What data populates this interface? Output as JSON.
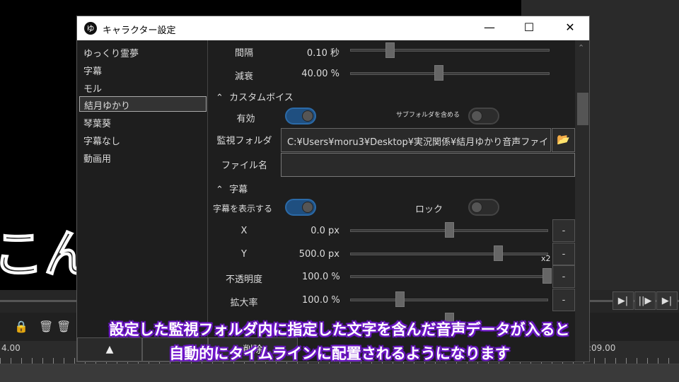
{
  "preview": {
    "text": "こんに"
  },
  "playback": {
    "buttons": [
      {
        "icon": "step-play-icon",
        "glyph": "▶|"
      },
      {
        "icon": "frame-forward-icon",
        "glyph": "||▶"
      },
      {
        "icon": "skip-end-icon",
        "glyph": "▶|"
      }
    ]
  },
  "timeline": {
    "time_left": "4.00",
    "time_right": ":09.00"
  },
  "window": {
    "title": "キャラクター設定",
    "app_icon": "ゆ",
    "min": "—",
    "max": "☐",
    "close": "✕"
  },
  "list": {
    "items": [
      "ゆっくり霊夢",
      "字幕",
      "モル",
      "結月ゆかり",
      "琴葉葵",
      "字幕なし",
      "動画用"
    ],
    "selected": 3
  },
  "panel": {
    "interval": {
      "label": "間隔",
      "value": "0.10 秒",
      "fraction": 0.07
    },
    "decay": {
      "label": "減衰",
      "value": "40.00 %",
      "fraction": 0.4
    },
    "custom_voice": {
      "header": "カスタムボイス",
      "enabled_label": "有効",
      "enabled": true,
      "subfolder_label": "サブフォルダを含める",
      "subfolder": false,
      "folder_label": "監視フォルダ",
      "folder_value": "C:¥Users¥moru3¥Desktop¥実況関係¥結月ゆかり音声ファイ",
      "filename_label": "ファイル名",
      "filename_value": ""
    },
    "subtitle": {
      "header": "字幕",
      "show_label": "字幕を表示する",
      "show": true,
      "lock_label": "ロック",
      "lock": false,
      "rows": [
        {
          "label": "X",
          "value": "0.0 px",
          "fraction": 0.5
        },
        {
          "label": "Y",
          "value": "500.0 px",
          "fraction": 0.74
        },
        {
          "label": "不透明度",
          "value": "100.0 %",
          "fraction": 1.0
        },
        {
          "label": "拡大率",
          "value": "100.0 %",
          "fraction": 0.25
        }
      ],
      "x2": "x2",
      "minus": "-"
    }
  },
  "buttons": {
    "up": "▲",
    "down": "▼",
    "delete": "削除"
  },
  "caption": {
    "line1": "設定した監視フォルダ内に指定した文字を含んだ音声データが入ると",
    "line2": "自動的にタイムラインに配置されるようになります"
  }
}
